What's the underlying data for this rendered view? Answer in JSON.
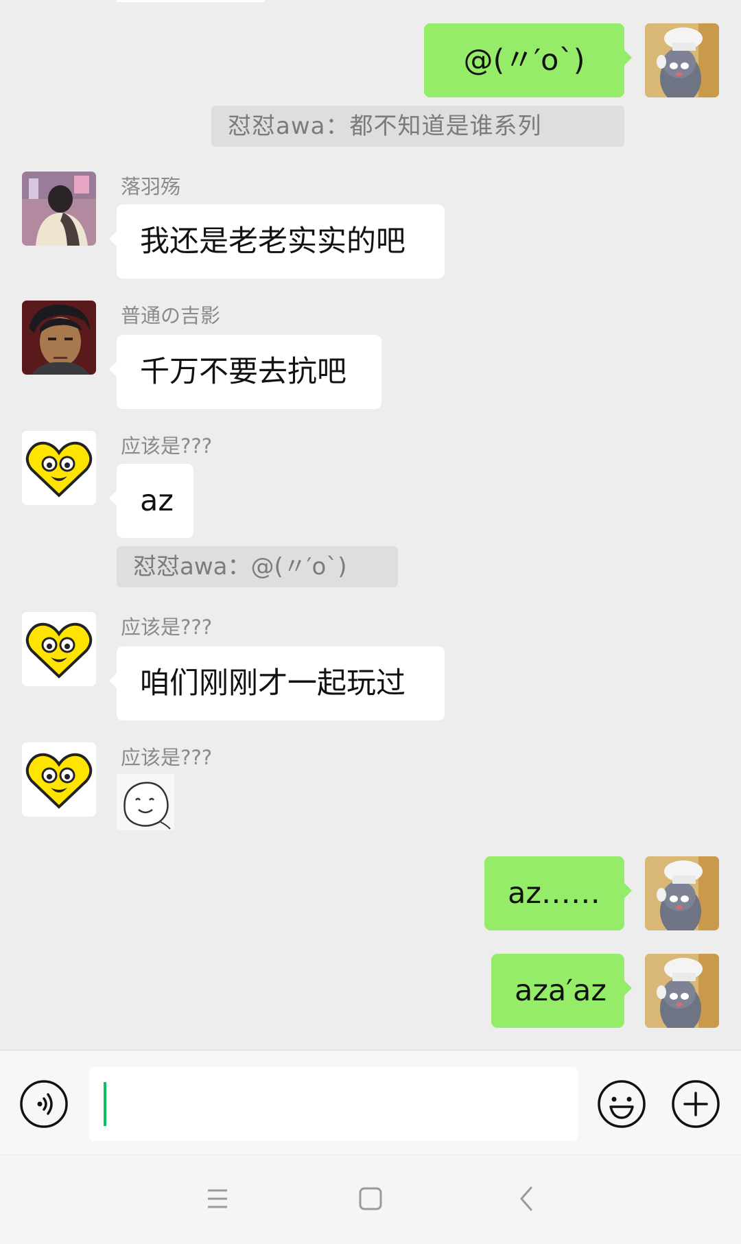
{
  "messages": [
    {
      "side": "out",
      "text": "@(〃′o`)"
    },
    {
      "type": "quote",
      "text": "怼怼awa：都不知道是谁系列"
    },
    {
      "side": "in",
      "sender": "落羽殇",
      "text": "我还是老老实实的吧"
    },
    {
      "side": "in",
      "sender": "普通の吉影",
      "text": "千万不要去抗吧"
    },
    {
      "side": "in",
      "sender": "应该是???",
      "text": "az"
    },
    {
      "type": "quote",
      "text": "怼怼awa：@(〃′o`)"
    },
    {
      "side": "in",
      "sender": "应该是???",
      "text": "咱们刚刚才一起玩过"
    },
    {
      "side": "in",
      "sender": "应该是???",
      "sticker": "smile-face-sticker"
    },
    {
      "side": "out",
      "text": "az……"
    },
    {
      "side": "out",
      "text": "aza′az"
    }
  ],
  "input": {
    "value": "",
    "placeholder": ""
  },
  "icons": {
    "voice": "voice-icon",
    "emoji": "emoji-icon",
    "plus": "plus-icon",
    "menu": "menu-icon",
    "home": "home-icon",
    "back": "back-icon"
  },
  "colors": {
    "background": "#ededed",
    "outgoing_bubble": "#95ec69",
    "incoming_bubble": "#ffffff",
    "caret": "#07c160"
  }
}
